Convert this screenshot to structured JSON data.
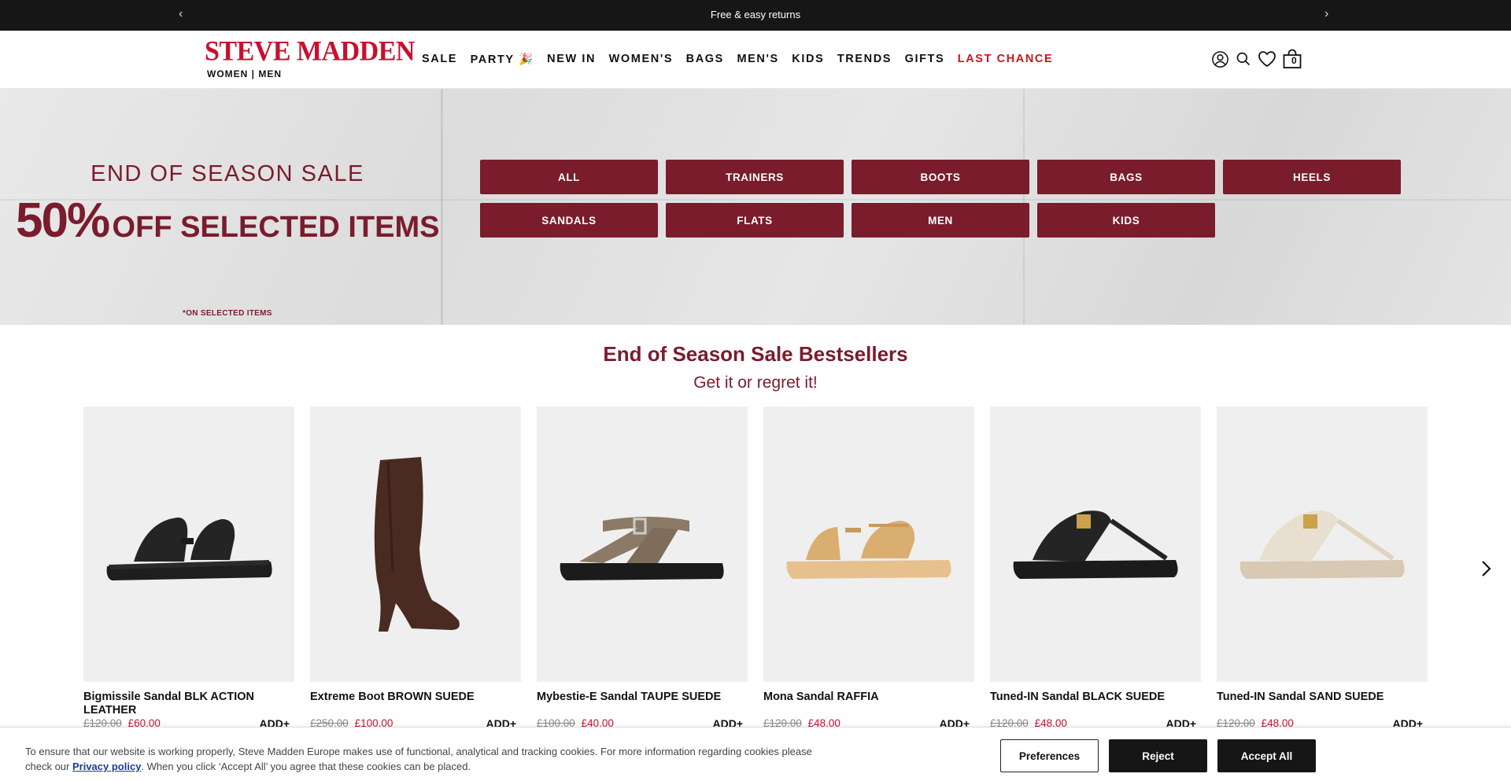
{
  "announcement": {
    "message": "Free & easy returns",
    "prev_arrow": "‹",
    "next_arrow": "›"
  },
  "header": {
    "logo": "STEVE MADDEN",
    "logo_sub": "WOMEN | MEN",
    "nav": [
      {
        "label": "SALE"
      },
      {
        "label": "PARTY 🎉"
      },
      {
        "label": "NEW IN"
      },
      {
        "label": "WOMEN'S"
      },
      {
        "label": "BAGS"
      },
      {
        "label": "MEN'S"
      },
      {
        "label": "KIDS"
      },
      {
        "label": "TRENDS"
      },
      {
        "label": "GIFTS"
      },
      {
        "label": "LAST CHANCE"
      }
    ],
    "icons": [
      "account-icon",
      "search-icon",
      "wishlist-heart-icon",
      "shopping-bag-icon"
    ],
    "bag_count": "0",
    "accent_color": "#c8102e"
  },
  "hero": {
    "kicker": "END OF SEASON SALE",
    "percent": "50%",
    "headline_rest": "OFF SELECTED ITEMS",
    "note": "*ON SELECTED ITEMS",
    "button_color": "#7a1c2c",
    "categories": [
      "ALL",
      "TRAINERS",
      "BOOTS",
      "BAGS",
      "HEELS",
      "SANDALS",
      "FLATS",
      "MEN",
      "KIDS"
    ]
  },
  "bestsellers": {
    "title": "End of Season Sale Bestsellers",
    "subtitle": "Get it or regret it!",
    "add_label": "ADD+",
    "products": [
      {
        "name": "Bigmissile Sandal BLK ACTION LEATHER",
        "old_price": "£120.00",
        "price": "£60.00"
      },
      {
        "name": "Extreme Boot BROWN SUEDE",
        "old_price": "£250.00",
        "price": "£100.00"
      },
      {
        "name": "Mybestie-E Sandal TAUPE SUEDE",
        "old_price": "£100.00",
        "price": "£40.00"
      },
      {
        "name": "Mona Sandal RAFFIA",
        "old_price": "£120.00",
        "price": "£48.00"
      },
      {
        "name": "Tuned-IN Sandal BLACK SUEDE",
        "old_price": "£120.00",
        "price": "£48.00"
      },
      {
        "name": "Tuned-IN Sandal SAND SUEDE",
        "old_price": "£120.00",
        "price": "£48.00"
      }
    ]
  },
  "cookie": {
    "text_before": "To ensure that our website is working properly, Steve Madden Europe makes use of functional, analytical and tracking cookies. For more information regarding cookies please check our ",
    "link": "Privacy policy",
    "text_after": ". When you click ‘Accept All’ you agree that these cookies can be placed.",
    "preferences": "Preferences",
    "reject": "Reject",
    "accept": "Accept All"
  }
}
